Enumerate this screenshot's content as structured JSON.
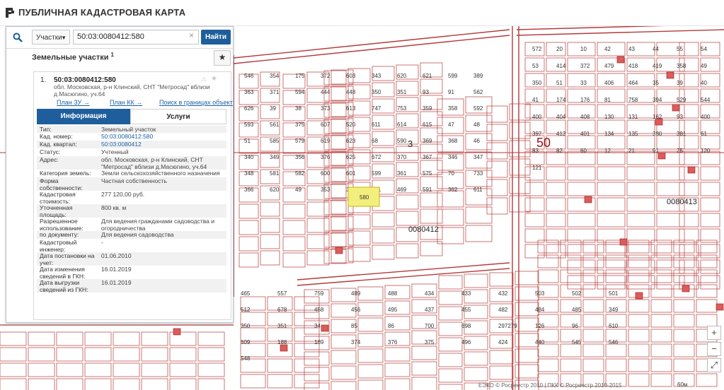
{
  "header": {
    "title": "ПУБЛИЧНАЯ КАДАСТРОВАЯ КАРТА"
  },
  "search": {
    "type": "Участки",
    "query": "50:03:0080412:580",
    "button": "Найти"
  },
  "results": {
    "title": "Земельные участки",
    "count": "1"
  },
  "object": {
    "index": "1.",
    "cadnum": "50:03:0080412:580",
    "address": "обл. Московская, р-н Клинский, СНТ \"Метросад\" вблизи д.Масюгино, уч.64",
    "links": [
      "План ЗУ →",
      "План КК →",
      "Поиск в границах объекта →"
    ]
  },
  "tabs": {
    "info": "Информация",
    "services": "Услуги"
  },
  "attributes": [
    {
      "k": "Тип:",
      "v": "Земельный участок"
    },
    {
      "k": "Кад. номер:",
      "v": "50:03:0080412:580"
    },
    {
      "k": "Кад. квартал:",
      "v": "50:03:0080412"
    },
    {
      "k": "Статус:",
      "v": "Учтенный"
    },
    {
      "k": "Адрес:",
      "v": "обл. Московская, р-н Клинский, СНТ \"Метросад\" вблизи д.Масюгино, уч.64"
    },
    {
      "k": "Категория земель:",
      "v": "Земли сельскохозяйственного назначения"
    },
    {
      "k": "Форма собственности:",
      "v": "Частная собственность"
    },
    {
      "k": "Кадастровая стоимость:",
      "v": "277 120,00 руб."
    },
    {
      "k": "Уточненная площадь:",
      "v": "800 кв. м"
    },
    {
      "k": "Разрешенное использование:",
      "v": "Для ведения гражданами садоводства и огородничества"
    },
    {
      "k": "по документу:",
      "v": "Для ведения садоводства"
    },
    {
      "k": "Кадастровый инженер:",
      "v": "-"
    },
    {
      "k": "Дата постановки на учет:",
      "v": "01.06.2010"
    },
    {
      "k": "Дата изменения сведений в ГКН:",
      "v": "16.01.2019"
    },
    {
      "k": "Дата выгрузки сведений из ГКН:",
      "v": "16.01.2019"
    }
  ],
  "map": {
    "district_labels": [
      "50",
      "50"
    ],
    "quarter_labels": [
      "0080412",
      "0080413",
      "3"
    ],
    "highlight_label": "580",
    "credits": "ЕЭКО © Росреестр 2010 | ПКК © Росреестр 2010-2015",
    "scale": "60м",
    "parcels_left": [
      {
        "label": "546"
      },
      {
        "label": "354"
      },
      {
        "label": "175"
      },
      {
        "label": "372"
      },
      {
        "label": "603"
      },
      {
        "label": "343"
      },
      {
        "label": "620"
      },
      {
        "label": "621"
      },
      {
        "label": "599"
      },
      {
        "label": "389"
      },
      {
        "label": "363"
      },
      {
        "label": "371"
      },
      {
        "label": "594"
      },
      {
        "label": "444"
      },
      {
        "label": "448"
      },
      {
        "label": "350"
      },
      {
        "label": "351"
      },
      {
        "label": "93"
      },
      {
        "label": "91"
      },
      {
        "label": "562"
      },
      {
        "label": "626"
      },
      {
        "label": "39"
      },
      {
        "label": "38"
      },
      {
        "label": "373"
      },
      {
        "label": "613"
      },
      {
        "label": "747"
      },
      {
        "label": "753"
      },
      {
        "label": "359"
      },
      {
        "label": "358"
      },
      {
        "label": "592"
      },
      {
        "label": "593"
      },
      {
        "label": "561"
      },
      {
        "label": "375"
      },
      {
        "label": "607"
      },
      {
        "label": "520"
      },
      {
        "label": "611"
      },
      {
        "label": "614"
      },
      {
        "label": "615"
      },
      {
        "label": "47"
      },
      {
        "label": "48"
      },
      {
        "label": "51"
      },
      {
        "label": "585"
      },
      {
        "label": "579"
      },
      {
        "label": "619"
      },
      {
        "label": "623"
      },
      {
        "label": "68"
      },
      {
        "label": "590"
      },
      {
        "label": "369"
      },
      {
        "label": "368"
      },
      {
        "label": "46"
      },
      {
        "label": "340"
      },
      {
        "label": "349"
      },
      {
        "label": "356"
      },
      {
        "label": "376"
      },
      {
        "label": "625"
      },
      {
        "label": "672"
      },
      {
        "label": "370"
      },
      {
        "label": "367"
      },
      {
        "label": "346"
      },
      {
        "label": "347"
      },
      {
        "label": "348"
      },
      {
        "label": "581"
      },
      {
        "label": "582"
      },
      {
        "label": "600"
      },
      {
        "label": "601"
      },
      {
        "label": "599"
      },
      {
        "label": "361"
      },
      {
        "label": "575"
      },
      {
        "label": "70"
      },
      {
        "label": "733"
      },
      {
        "label": "366"
      },
      {
        "label": "620"
      },
      {
        "label": "49"
      },
      {
        "label": "353"
      },
      {
        "label": "352"
      },
      {
        "label": "551"
      },
      {
        "label": "469"
      },
      {
        "label": "591"
      },
      {
        "label": "362"
      },
      {
        "label": "611"
      }
    ],
    "parcels_right": [
      {
        "label": "572"
      },
      {
        "label": "20"
      },
      {
        "label": "10"
      },
      {
        "label": "42"
      },
      {
        "label": "43"
      },
      {
        "label": "44"
      },
      {
        "label": "55"
      },
      {
        "label": "54"
      },
      {
        "label": "53"
      },
      {
        "label": "414"
      },
      {
        "label": "372"
      },
      {
        "label": "479"
      },
      {
        "label": "418"
      },
      {
        "label": "419"
      },
      {
        "label": "358"
      },
      {
        "label": "49"
      },
      {
        "label": "350"
      },
      {
        "label": "51"
      },
      {
        "label": "33"
      },
      {
        "label": "406"
      },
      {
        "label": "464"
      },
      {
        "label": "35"
      },
      {
        "label": "39"
      },
      {
        "label": "40"
      },
      {
        "label": "41"
      },
      {
        "label": "174"
      },
      {
        "label": "176"
      },
      {
        "label": "81"
      },
      {
        "label": "758"
      },
      {
        "label": "394"
      },
      {
        "label": "529"
      },
      {
        "label": "544"
      },
      {
        "label": "400"
      },
      {
        "label": "404"
      },
      {
        "label": "408"
      },
      {
        "label": "130"
      },
      {
        "label": "131"
      },
      {
        "label": "162"
      },
      {
        "label": "93"
      },
      {
        "label": "400"
      },
      {
        "label": "397"
      },
      {
        "label": "413"
      },
      {
        "label": "401"
      },
      {
        "label": "134"
      },
      {
        "label": "135"
      },
      {
        "label": "380"
      },
      {
        "label": "381"
      },
      {
        "label": "61"
      },
      {
        "label": "83"
      },
      {
        "label": "82"
      },
      {
        "label": "60"
      },
      {
        "label": "12"
      },
      {
        "label": "21"
      },
      {
        "label": "91"
      },
      {
        "label": "25"
      },
      {
        "label": "120"
      },
      {
        "label": "121"
      }
    ],
    "parcels_bottom": [
      {
        "label": "465"
      },
      {
        "label": "557"
      },
      {
        "label": "759"
      },
      {
        "label": "489"
      },
      {
        "label": "488"
      },
      {
        "label": "434"
      },
      {
        "label": "433"
      },
      {
        "label": "432"
      },
      {
        "label": "503"
      },
      {
        "label": "502"
      },
      {
        "label": "501"
      },
      {
        "label": "512"
      },
      {
        "label": "678"
      },
      {
        "label": "458"
      },
      {
        "label": "456"
      },
      {
        "label": "495"
      },
      {
        "label": "437"
      },
      {
        "label": "455"
      },
      {
        "label": "482"
      },
      {
        "label": "484"
      },
      {
        "label": "485"
      },
      {
        "label": "349"
      },
      {
        "label": "350"
      },
      {
        "label": "351"
      },
      {
        "label": "34"
      },
      {
        "label": "85"
      },
      {
        "label": "86"
      },
      {
        "label": "700"
      },
      {
        "label": "698"
      },
      {
        "label": "297279"
      },
      {
        "label": "126"
      },
      {
        "label": "96"
      },
      {
        "label": "610"
      },
      {
        "label": "609"
      },
      {
        "label": "188"
      },
      {
        "label": "189"
      },
      {
        "label": "374"
      },
      {
        "label": "376"
      },
      {
        "label": "375"
      },
      {
        "label": "496"
      },
      {
        "label": "424"
      },
      {
        "label": "440"
      },
      {
        "label": "545"
      },
      {
        "label": "546"
      },
      {
        "label": "548"
      }
    ]
  }
}
